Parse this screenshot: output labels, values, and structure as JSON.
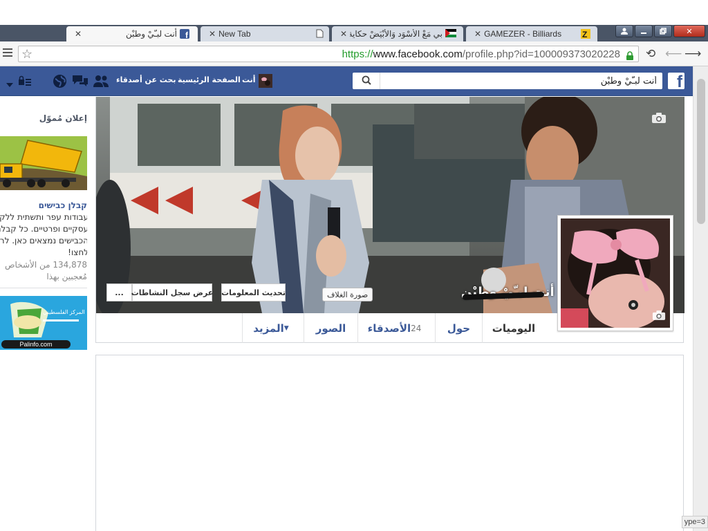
{
  "browser": {
    "tabs": [
      {
        "title": "أنت لبـّيْ وطبْن",
        "active": true,
        "favicon": "facebook-icon"
      },
      {
        "title": "New Tab",
        "active": false,
        "favicon": "none"
      },
      {
        "title": "بي مَعْ الأَسْوَد وَالأَبْيَضْ حكاية♥ - ا",
        "active": false,
        "favicon": "palestine-flag-icon"
      },
      {
        "title": "GAMEZER - Billiards",
        "active": false,
        "favicon": "gamezer-icon"
      }
    ],
    "url": {
      "scheme": "https://",
      "host": "www.facebook.com",
      "path": "/profile.php?id=100009373020228"
    },
    "status_text": "ype=3"
  },
  "facebook": {
    "search_value": "أنت لبـّيْ وطبْن",
    "nav": {
      "profile_label": "أنت",
      "home_label": "الصفحة الرئيسية",
      "find_friends_label": "بحث عن أصدقاء"
    },
    "cover": {
      "label": "صورة الغلاف",
      "update_info": "تحديث المعلومات",
      "activity_log": "عرض سجل النشاطات",
      "more": "..."
    },
    "profile_name": "أنت لبـّيْ وطبْن",
    "tabs": {
      "timeline": "اليوميات",
      "about": "حول",
      "friends": "الأصدقاء",
      "friends_count": "24",
      "photos": "الصور",
      "more": "المزيد"
    }
  },
  "ads": {
    "title": "إعلان مُموّل",
    "ad1": {
      "title": "קבלן כבישים",
      "lines": [
        "עבודות עפר ותשתית ללקוח",
        "עסקיים ופרטיים. כל קבלני",
        "הכבישים נמצאים כאן. לרשי",
        "לחצו!"
      ],
      "likes": [
        "134,878 من الأشخاص",
        "مُعجبين بهذا"
      ]
    },
    "ad2": {
      "label": "Palinfo.com"
    }
  },
  "colors": {
    "facebook_blue": "#3b5998",
    "url_green": "#239c2b",
    "chrome_dark": "#4a5566"
  }
}
